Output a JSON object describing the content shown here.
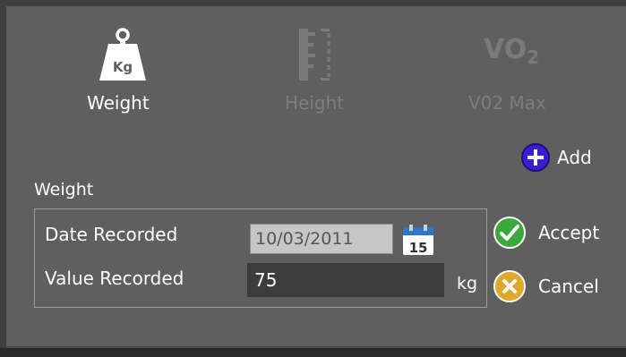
{
  "tabs": {
    "weight": {
      "label": "Weight",
      "icon": "weight-kg-icon",
      "icon_text": "Kg",
      "active": true
    },
    "height": {
      "label": "Height",
      "icon": "ruler-icon",
      "active": false
    },
    "vo2max": {
      "label": "V02 Max",
      "icon": "vo2-icon",
      "icon_text": "VO",
      "icon_sub": "2",
      "active": false
    }
  },
  "actions": {
    "add": {
      "label": "Add",
      "icon": "plus-circle-icon",
      "color": "#3a1fd1"
    },
    "accept": {
      "label": "Accept",
      "icon": "check-circle-icon",
      "color": "#3aa83a"
    },
    "cancel": {
      "label": "Cancel",
      "icon": "x-circle-icon",
      "color": "#e0a82a"
    }
  },
  "form": {
    "section_title": "Weight",
    "date_label": "Date Recorded",
    "date_value": "10/03/2011",
    "calendar_icon_day": "15",
    "value_label": "Value Recorded",
    "value_value": "75",
    "unit": "kg"
  },
  "colors": {
    "background": "#5f5f5f",
    "frame": "#3f3f3f",
    "inactive_text": "#7d7d7d",
    "active_text": "#ffffff"
  }
}
